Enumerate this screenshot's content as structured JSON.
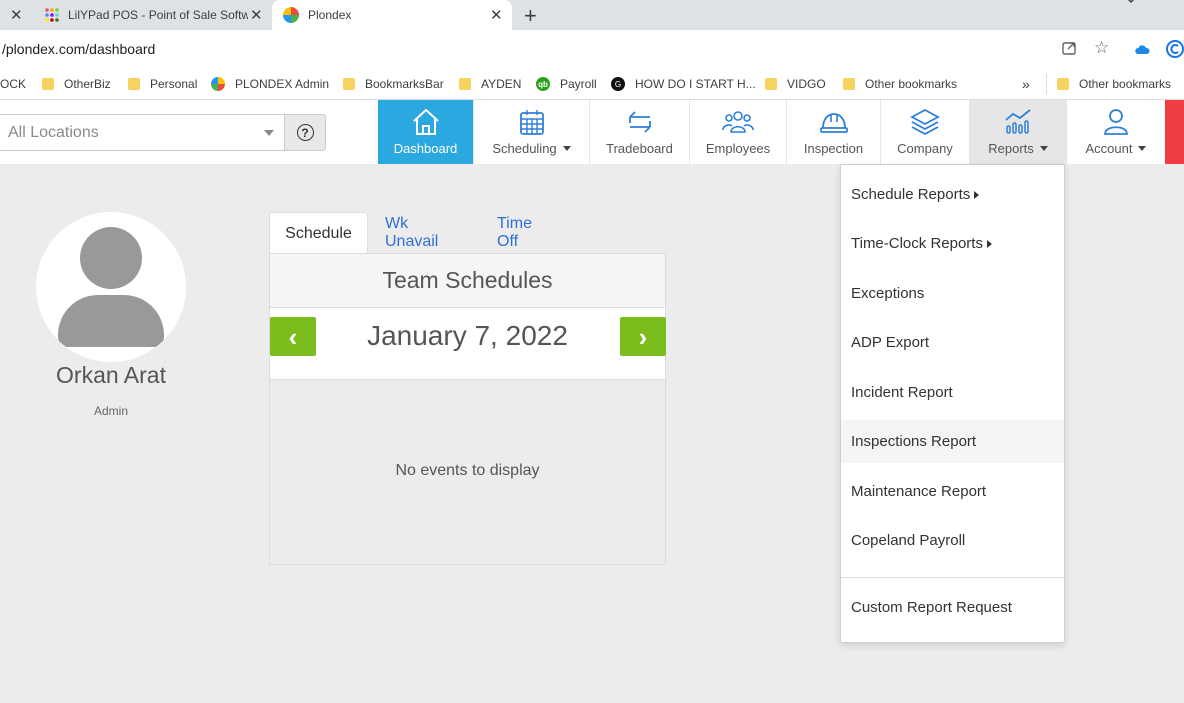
{
  "browser": {
    "tabs": [
      {
        "title": "LilYPad POS - Point of Sale Softw",
        "active": false
      },
      {
        "title": "Plondex",
        "active": true
      }
    ],
    "url": "/plondex.com/dashboard",
    "bookmarks": [
      {
        "label": "OCK",
        "type": "text"
      },
      {
        "label": "OtherBiz",
        "type": "folder"
      },
      {
        "label": "Personal",
        "type": "folder"
      },
      {
        "label": "PLONDEX Admin",
        "type": "site"
      },
      {
        "label": "BookmarksBar",
        "type": "folder"
      },
      {
        "label": "AYDEN",
        "type": "folder"
      },
      {
        "label": "Payroll",
        "type": "site"
      },
      {
        "label": "HOW DO I START H...",
        "type": "site"
      },
      {
        "label": "VIDGO",
        "type": "folder"
      },
      {
        "label": "Other bookmarks",
        "type": "folder"
      }
    ],
    "overflow_label": "»",
    "other_bookmarks": "Other bookmarks"
  },
  "header": {
    "location_select": "All Locations",
    "help": "?",
    "nav": [
      {
        "label": "Dashboard",
        "icon": "home-icon",
        "active": true,
        "dropdown": false
      },
      {
        "label": "Scheduling",
        "icon": "calendar-icon",
        "active": false,
        "dropdown": true
      },
      {
        "label": "Tradeboard",
        "icon": "swap-icon",
        "active": false,
        "dropdown": false
      },
      {
        "label": "Employees",
        "icon": "people-icon",
        "active": false,
        "dropdown": false
      },
      {
        "label": "Inspection",
        "icon": "hardhat-icon",
        "active": false,
        "dropdown": false
      },
      {
        "label": "Company",
        "icon": "layers-icon",
        "active": false,
        "dropdown": false
      },
      {
        "label": "Reports",
        "icon": "chart-icon",
        "active": false,
        "dropdown": true
      },
      {
        "label": "Account",
        "icon": "user-icon",
        "active": false,
        "dropdown": true
      }
    ]
  },
  "profile": {
    "name": "Orkan Arat",
    "role": "Admin"
  },
  "schedule": {
    "tabs": [
      "Schedule",
      "Wk Unavail",
      "Time Off"
    ],
    "title": "Team Schedules",
    "date": "January 7, 2022",
    "empty": "No events to display",
    "prev": "‹",
    "next": "›"
  },
  "reports_menu": {
    "items": [
      {
        "label": "Schedule Reports",
        "submenu": true
      },
      {
        "label": "Time-Clock Reports",
        "submenu": true
      },
      {
        "label": "Exceptions",
        "submenu": false
      },
      {
        "label": "ADP Export",
        "submenu": false
      },
      {
        "label": "Incident Report",
        "submenu": false
      },
      {
        "label": "Inspections Report",
        "submenu": false
      },
      {
        "label": "Maintenance Report",
        "submenu": false
      },
      {
        "label": "Copeland Payroll",
        "submenu": false
      },
      {
        "label": "Custom Report Request",
        "submenu": false
      }
    ]
  },
  "colors": {
    "nav_active": "#2ba8e0",
    "arrow_button": "#7cbd1e",
    "link": "#2f6fd6"
  }
}
